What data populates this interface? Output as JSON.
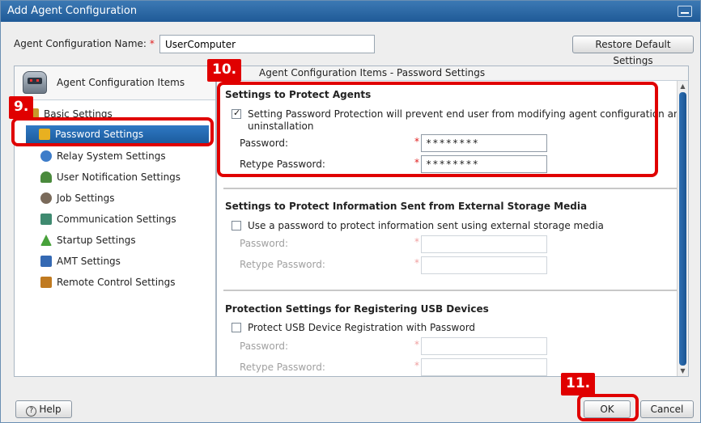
{
  "window": {
    "title": "Add Agent Configuration"
  },
  "name_row": {
    "label": "Agent Configuration Name:",
    "required_mark": "*",
    "value": "UserComputer",
    "restore_button": "Restore Default Settings"
  },
  "left_panel": {
    "header": "Agent Configuration Items",
    "items": [
      {
        "label": "Basic Settings",
        "icon": "basic-settings-icon",
        "icon_color": "#c89a2b"
      },
      {
        "label": "Password Settings",
        "icon": "key-icon",
        "icon_color": "#e8b020",
        "selected": true
      },
      {
        "label": "Relay System Settings",
        "icon": "relay-icon",
        "icon_color": "#3d7cc9"
      },
      {
        "label": "User Notification Settings",
        "icon": "user-notification-icon",
        "icon_color": "#4a8a3c"
      },
      {
        "label": "Job Settings",
        "icon": "job-icon",
        "icon_color": "#7a6a5a"
      },
      {
        "label": "Communication Settings",
        "icon": "communication-icon",
        "icon_color": "#3f8a70"
      },
      {
        "label": "Startup Settings",
        "icon": "startup-icon",
        "icon_color": "#47a13a"
      },
      {
        "label": "AMT Settings",
        "icon": "amt-icon",
        "icon_color": "#3469b3"
      },
      {
        "label": "Remote Control Settings",
        "icon": "remote-control-icon",
        "icon_color": "#c07a20"
      }
    ]
  },
  "right_panel": {
    "header": "Agent Configuration Items - Password Settings",
    "sections": [
      {
        "title": "Settings to Protect Agents",
        "checkbox_label": "Setting Password Protection will prevent end user from modifying agent configuration and",
        "checkbox_label_line2": "uninstallation",
        "checked": true,
        "password_label": "Password:",
        "password_value": "********",
        "retype_label": "Retype Password:",
        "retype_value": "********"
      },
      {
        "title": "Settings to Protect Information Sent from External Storage Media",
        "checkbox_label": "Use a password to protect information sent using external storage media",
        "checked": false,
        "password_label": "Password:",
        "password_value": "",
        "retype_label": "Retype Password:",
        "retype_value": ""
      },
      {
        "title": "Protection Settings for Registering USB Devices",
        "checkbox_label": "Protect USB Device Registration with Password",
        "checked": false,
        "password_label": "Password:",
        "password_value": "",
        "retype_label": "Retype Password:",
        "retype_value": ""
      }
    ],
    "required_mark": "*"
  },
  "footer": {
    "help_button": "Help",
    "help_icon_glyph": "?",
    "ok_button": "OK",
    "cancel_button": "Cancel"
  },
  "annotations": {
    "step9": "9.",
    "step10": "10.",
    "step11": "11.",
    "color": "#e00000"
  }
}
